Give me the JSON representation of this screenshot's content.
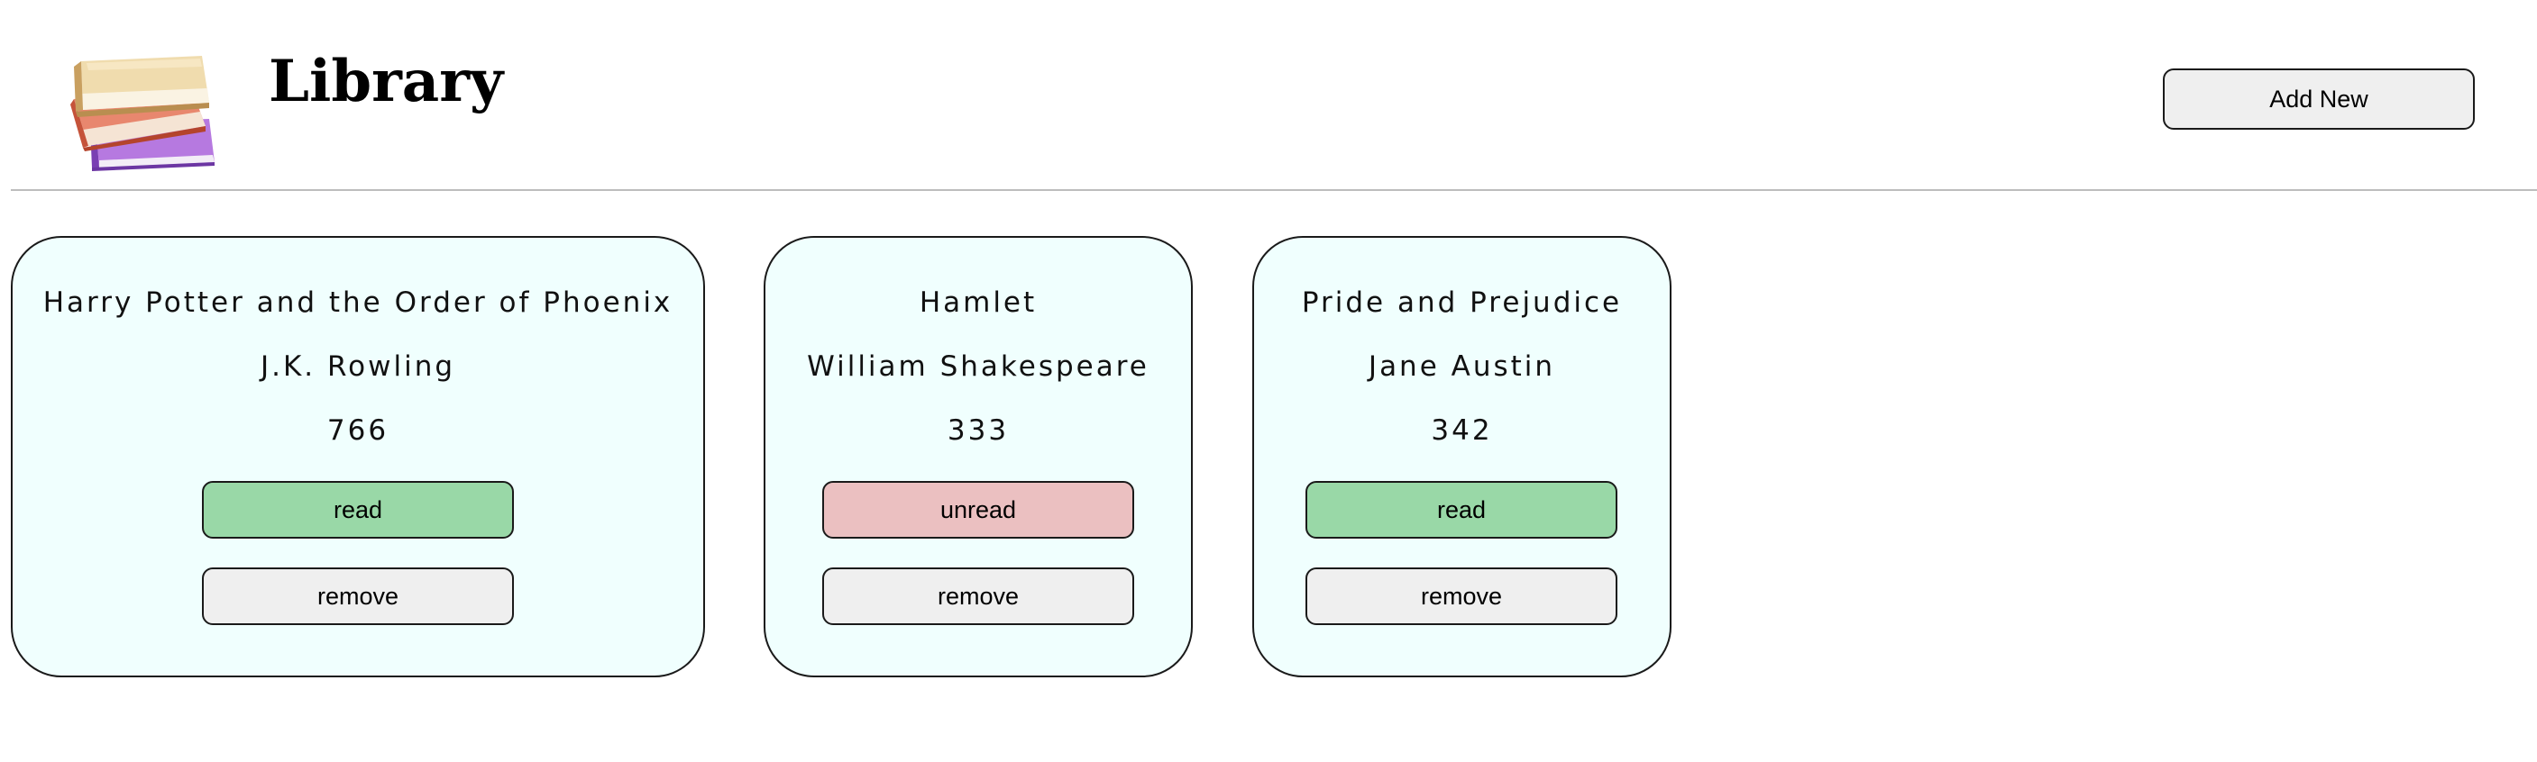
{
  "header": {
    "logo_icon": "stack-of-books-icon",
    "title": "Library",
    "add_button_label": "Add New"
  },
  "books": [
    {
      "title": "Harry Potter and the Order of Phoenix",
      "author": "J.K. Rowling",
      "pages": "766",
      "status_label": "read",
      "status_color": "#99d8a7",
      "remove_label": "remove"
    },
    {
      "title": "Hamlet",
      "author": "William Shakespeare",
      "pages": "333",
      "status_label": "unread",
      "status_color": "#ebc0c1",
      "remove_label": "remove"
    },
    {
      "title": "Pride and Prejudice",
      "author": "Jane Austin",
      "pages": "342",
      "status_label": "read",
      "status_color": "#99d8a7",
      "remove_label": "remove"
    }
  ],
  "colors": {
    "card_background": "#f0fffe",
    "read": "#99d8a7",
    "unread": "#ebc0c1",
    "neutral_button": "#efefef"
  }
}
